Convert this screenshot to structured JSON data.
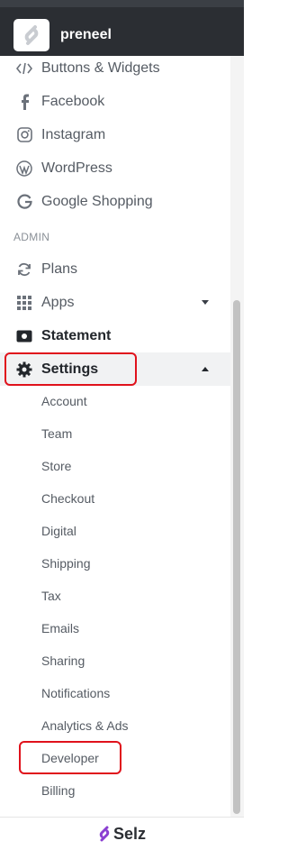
{
  "store": {
    "name": "preneel"
  },
  "nav": {
    "channels": [
      {
        "label": "Buttons & Widgets",
        "icon": "code-icon"
      },
      {
        "label": "Facebook",
        "icon": "facebook-icon"
      },
      {
        "label": "Instagram",
        "icon": "instagram-icon"
      },
      {
        "label": "WordPress",
        "icon": "wordpress-icon"
      },
      {
        "label": "Google Shopping",
        "icon": "google-icon"
      }
    ],
    "admin_title": "ADMIN",
    "admin": [
      {
        "label": "Plans",
        "icon": "refresh-icon"
      },
      {
        "label": "Apps",
        "icon": "grid-icon"
      },
      {
        "label": "Statement",
        "icon": "money-icon"
      },
      {
        "label": "Settings",
        "icon": "gear-icon"
      }
    ],
    "settings_sub": [
      "Account",
      "Team",
      "Store",
      "Checkout",
      "Digital",
      "Shipping",
      "Tax",
      "Emails",
      "Sharing",
      "Notifications",
      "Analytics & Ads",
      "Developer",
      "Billing"
    ]
  },
  "footer": {
    "brand": "Selz"
  },
  "colors": {
    "highlight": "#e0121c",
    "brand": "#8a3fd1",
    "header": "#2b2e33"
  }
}
